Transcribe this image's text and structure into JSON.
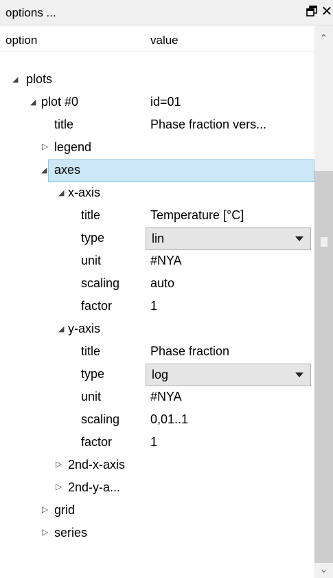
{
  "panel": {
    "title": "options ...",
    "float_icon": "▭",
    "close_icon": "✕"
  },
  "columns": {
    "option": "option",
    "value": "value"
  },
  "tree": {
    "plots": {
      "label": "plots"
    },
    "plot0": {
      "label": "plot #0",
      "value": "id=01"
    },
    "plot0_title": {
      "label": "title",
      "value": "Phase fraction vers..."
    },
    "legend": {
      "label": "legend"
    },
    "axes": {
      "label": "axes"
    },
    "x_axis": {
      "label": "x-axis",
      "title": {
        "label": "title",
        "value": "Temperature [°C]"
      },
      "type": {
        "label": "type",
        "value": "lin"
      },
      "unit": {
        "label": "unit",
        "value": "#NYA"
      },
      "scaling": {
        "label": "scaling",
        "value": "auto"
      },
      "factor": {
        "label": "factor",
        "value": "1"
      }
    },
    "y_axis": {
      "label": "y-axis",
      "title": {
        "label": "title",
        "value": "Phase fraction"
      },
      "type": {
        "label": "type",
        "value": "log"
      },
      "unit": {
        "label": "unit",
        "value": "#NYA"
      },
      "scaling": {
        "label": "scaling",
        "value": "0,01..1"
      },
      "factor": {
        "label": "factor",
        "value": "1"
      }
    },
    "second_x_axis": {
      "label": "2nd-x-axis"
    },
    "second_y_axis": {
      "label": "2nd-y-a..."
    },
    "grid": {
      "label": "grid"
    },
    "series": {
      "label": "series"
    }
  },
  "colors": {
    "selection_bg": "#cce8f7",
    "selection_border": "#8fc8ea",
    "scroll_thumb": "#cdcdcd"
  }
}
